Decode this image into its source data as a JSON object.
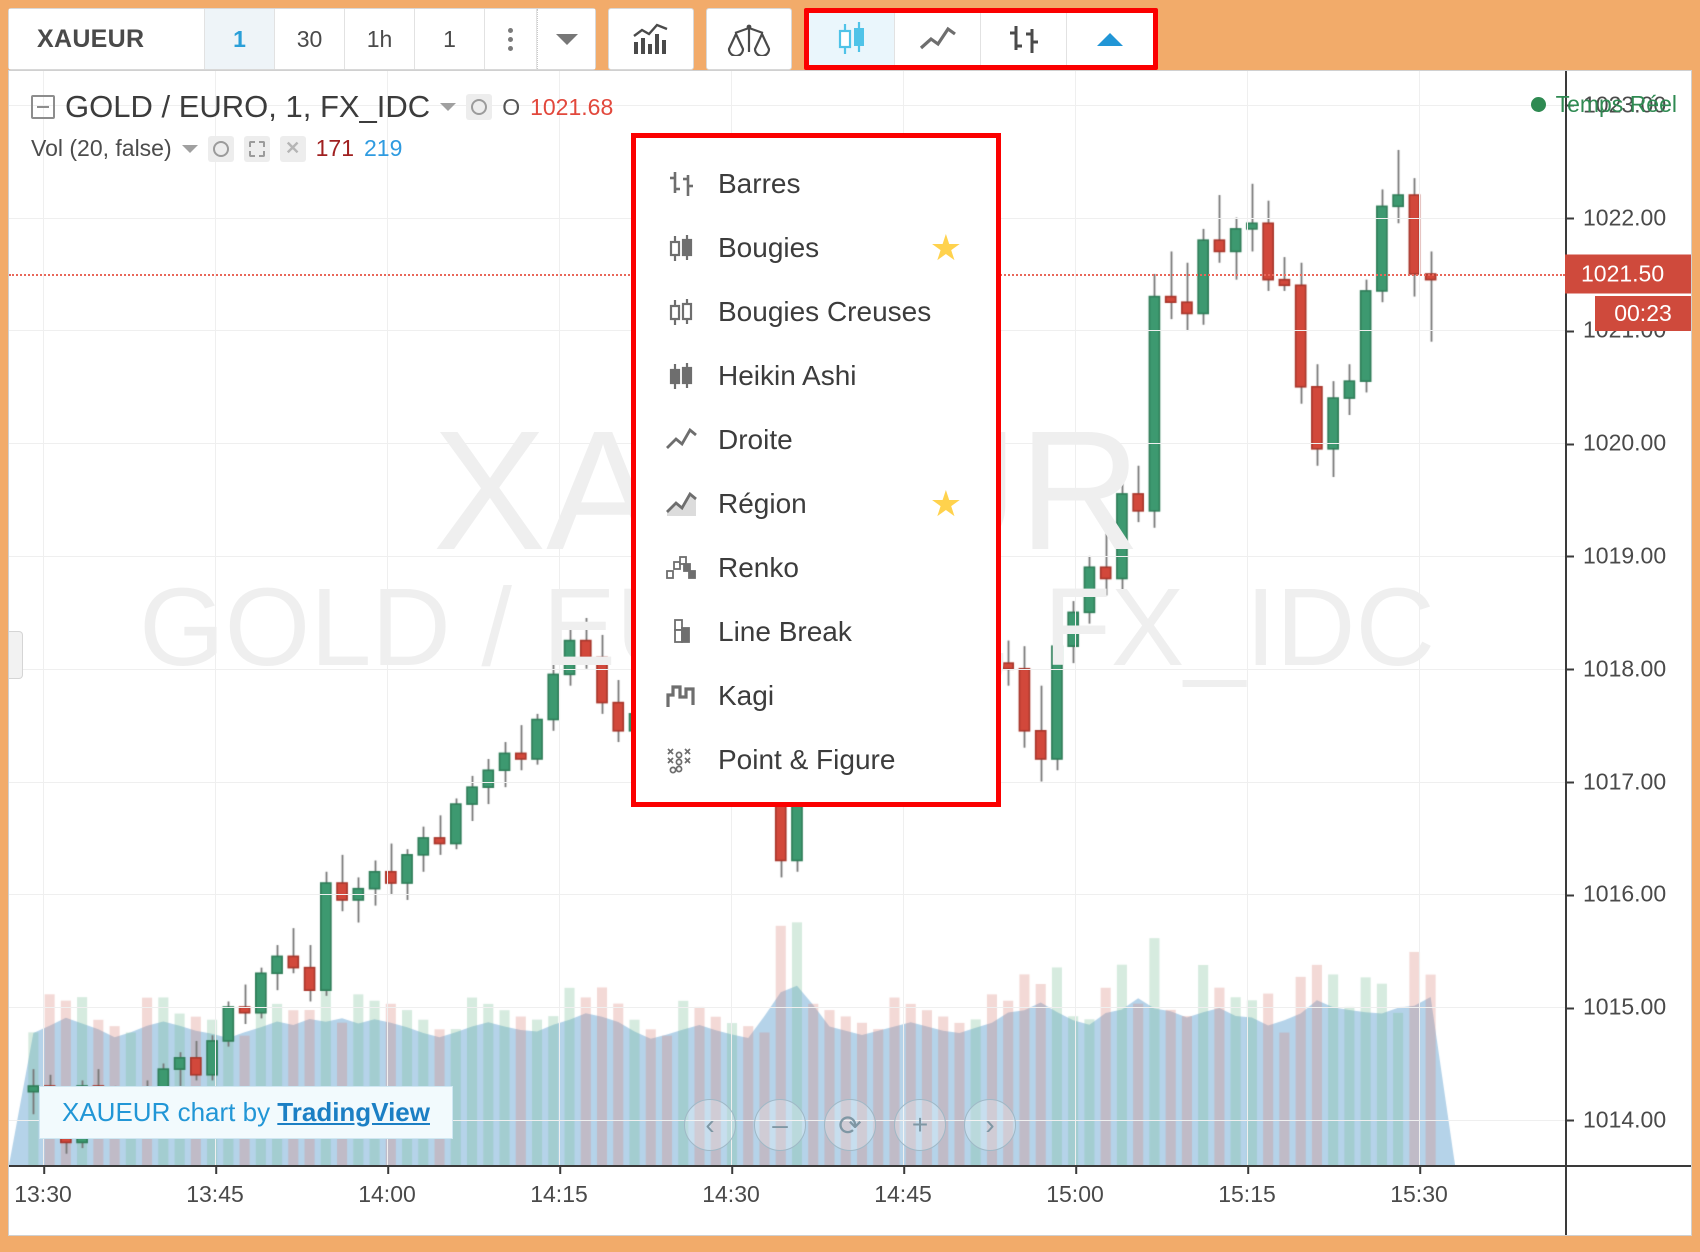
{
  "toolbar": {
    "symbol": "XAUEUR",
    "intervals": [
      {
        "label": "1",
        "active": true
      },
      {
        "label": "30",
        "active": false
      },
      {
        "label": "1h",
        "active": false
      },
      {
        "label": "1",
        "active": false
      }
    ],
    "more_icon": "kebab-menu-icon",
    "caret_icon": "chevron-down-icon",
    "indicators_icon": "indicators-chart-icon",
    "compare_icon": "balance-scale-icon",
    "styles": [
      {
        "name": "candles-icon",
        "selected": true
      },
      {
        "name": "line-icon",
        "selected": false
      },
      {
        "name": "bars-icon",
        "selected": false
      }
    ],
    "expand_icon": "triangle-up-icon"
  },
  "style_menu": {
    "items": [
      {
        "label": "Barres",
        "icon": "bars-icon",
        "starred": false
      },
      {
        "label": "Bougies",
        "icon": "candles-icon",
        "starred": true
      },
      {
        "label": "Bougies Creuses",
        "icon": "hollow-candles-icon",
        "starred": false
      },
      {
        "label": "Heikin Ashi",
        "icon": "heikin-ashi-icon",
        "starred": false
      },
      {
        "label": "Droite",
        "icon": "line-icon",
        "starred": false
      },
      {
        "label": "Région",
        "icon": "area-icon",
        "starred": true
      },
      {
        "label": "Renko",
        "icon": "renko-icon",
        "starred": false
      },
      {
        "label": "Line Break",
        "icon": "line-break-icon",
        "starred": false
      },
      {
        "label": "Kagi",
        "icon": "kagi-icon",
        "starred": false
      },
      {
        "label": "Point & Figure",
        "icon": "point-and-figure-icon",
        "starred": false
      }
    ],
    "star_glyph": "★"
  },
  "legend": {
    "collapse_icon": "collapse-icon",
    "title": "GOLD / EURO, 1, FX_IDC",
    "title_caret": "chevron-down-icon",
    "visibility_icon": "eye-icon",
    "ohlc_label": "O",
    "ohlc_value": "1021.68",
    "study_name": "Vol (20, false)",
    "study_caret": "chevron-down-icon",
    "study_eye_icon": "eye-icon",
    "study_gear_icon": "gear-icon",
    "study_close_icon": "close-icon",
    "study_value_1": "171",
    "study_value_2": "219"
  },
  "realtime": {
    "label": "Temps Réel",
    "dot_color": "#2f8a52"
  },
  "price_badge": {
    "price": "1021.50",
    "countdown": "00:23",
    "color": "#cf4a3c"
  },
  "tv_badge": {
    "prefix": "XAUEUR chart by ",
    "brand": "TradingView"
  },
  "nav_controls": [
    {
      "name": "scroll-left-button",
      "glyph": "‹"
    },
    {
      "name": "zoom-out-button",
      "glyph": "–"
    },
    {
      "name": "reset-chart-button",
      "glyph": "⟳"
    },
    {
      "name": "zoom-in-button",
      "glyph": "+"
    },
    {
      "name": "scroll-right-button",
      "glyph": "›"
    }
  ],
  "chart_data": {
    "type": "candlestick",
    "title": "GOLD / EURO, 1, FX_IDC",
    "symbol": "XAUEUR",
    "interval": "1",
    "source": "FX_IDC",
    "xlabel": "",
    "ylabel": "",
    "grid": true,
    "legend": "top-left",
    "ylim": [
      1013.6,
      1023.3
    ],
    "price_ticks": [
      "1023.00",
      "1022.00",
      "1021.00",
      "1020.00",
      "1019.00",
      "1018.00",
      "1017.00",
      "1016.00",
      "1015.00",
      "1014.00"
    ],
    "time_ticks": [
      "13:30",
      "13:45",
      "14:00",
      "14:15",
      "14:30",
      "14:45",
      "15:00",
      "15:15",
      "15:30"
    ],
    "current_price": 1021.5,
    "open_value": 1021.68,
    "up_color": "#3d9970",
    "down_color": "#d2483b",
    "volume_panel": {
      "label": "Vol (20, false)",
      "ma_value": 171,
      "last_value": 219,
      "area_color": "#8ec3e0"
    },
    "ohlc": [
      [
        1014.25,
        1014.45,
        1014.05,
        1014.3
      ],
      [
        1014.3,
        1014.4,
        1013.95,
        1014.0
      ],
      [
        1014.0,
        1014.15,
        1013.7,
        1013.8
      ],
      [
        1013.8,
        1014.35,
        1013.75,
        1014.3
      ],
      [
        1014.3,
        1014.45,
        1014.1,
        1014.15
      ],
      [
        1014.15,
        1014.3,
        1013.95,
        1014.05
      ],
      [
        1014.05,
        1014.25,
        1013.9,
        1014.2
      ],
      [
        1014.2,
        1014.35,
        1014.0,
        1014.1
      ],
      [
        1014.1,
        1014.5,
        1014.05,
        1014.45
      ],
      [
        1014.45,
        1014.6,
        1014.3,
        1014.55
      ],
      [
        1014.55,
        1014.7,
        1014.35,
        1014.4
      ],
      [
        1014.4,
        1014.75,
        1014.35,
        1014.7
      ],
      [
        1014.7,
        1015.05,
        1014.65,
        1015.0
      ],
      [
        1015.0,
        1015.2,
        1014.85,
        1014.95
      ],
      [
        1014.95,
        1015.35,
        1014.9,
        1015.3
      ],
      [
        1015.3,
        1015.55,
        1015.15,
        1015.45
      ],
      [
        1015.45,
        1015.7,
        1015.3,
        1015.35
      ],
      [
        1015.35,
        1015.55,
        1015.05,
        1015.15
      ],
      [
        1015.15,
        1016.2,
        1015.1,
        1016.1
      ],
      [
        1016.1,
        1016.35,
        1015.85,
        1015.95
      ],
      [
        1015.95,
        1016.15,
        1015.75,
        1016.05
      ],
      [
        1016.05,
        1016.3,
        1015.9,
        1016.2
      ],
      [
        1016.2,
        1016.45,
        1016.0,
        1016.1
      ],
      [
        1016.1,
        1016.4,
        1015.95,
        1016.35
      ],
      [
        1016.35,
        1016.6,
        1016.2,
        1016.5
      ],
      [
        1016.5,
        1016.7,
        1016.35,
        1016.45
      ],
      [
        1016.45,
        1016.85,
        1016.4,
        1016.8
      ],
      [
        1016.8,
        1017.05,
        1016.65,
        1016.95
      ],
      [
        1016.95,
        1017.2,
        1016.8,
        1017.1
      ],
      [
        1017.1,
        1017.35,
        1016.95,
        1017.25
      ],
      [
        1017.25,
        1017.5,
        1017.1,
        1017.2
      ],
      [
        1017.2,
        1017.6,
        1017.15,
        1017.55
      ],
      [
        1017.55,
        1018.05,
        1017.45,
        1017.95
      ],
      [
        1017.95,
        1018.35,
        1017.85,
        1018.25
      ],
      [
        1018.25,
        1018.45,
        1018.0,
        1018.1
      ],
      [
        1018.1,
        1018.3,
        1017.6,
        1017.7
      ],
      [
        1017.7,
        1017.9,
        1017.35,
        1017.45
      ],
      [
        1017.45,
        1017.7,
        1017.3,
        1017.6
      ],
      [
        1017.6,
        1017.8,
        1017.45,
        1017.55
      ],
      [
        1017.55,
        1017.75,
        1017.4,
        1017.5
      ],
      [
        1017.5,
        1017.7,
        1017.35,
        1017.6
      ],
      [
        1017.6,
        1017.8,
        1017.45,
        1017.55
      ],
      [
        1017.55,
        1017.7,
        1017.4,
        1017.45
      ],
      [
        1017.45,
        1017.65,
        1017.35,
        1017.55
      ],
      [
        1017.55,
        1017.75,
        1017.4,
        1017.5
      ],
      [
        1017.5,
        1017.65,
        1017.3,
        1017.4
      ],
      [
        1017.4,
        1017.6,
        1016.15,
        1016.3
      ],
      [
        1016.3,
        1018.55,
        1016.2,
        1018.45
      ],
      [
        1018.45,
        1018.7,
        1018.25,
        1018.4
      ],
      [
        1018.4,
        1018.6,
        1018.15,
        1018.3
      ],
      [
        1018.3,
        1018.5,
        1018.05,
        1018.2
      ],
      [
        1018.2,
        1018.4,
        1017.95,
        1018.1
      ],
      [
        1018.1,
        1018.3,
        1017.85,
        1018.0
      ],
      [
        1018.0,
        1018.2,
        1017.8,
        1017.95
      ],
      [
        1017.95,
        1018.15,
        1017.75,
        1017.9
      ],
      [
        1017.9,
        1018.1,
        1017.7,
        1017.85
      ],
      [
        1017.85,
        1018.05,
        1017.65,
        1017.8
      ],
      [
        1017.8,
        1018.0,
        1017.6,
        1017.75
      ],
      [
        1017.75,
        1018.25,
        1017.7,
        1018.15
      ],
      [
        1018.15,
        1018.35,
        1017.95,
        1018.05
      ],
      [
        1018.05,
        1018.25,
        1017.85,
        1018.0
      ],
      [
        1018.0,
        1018.2,
        1017.3,
        1017.45
      ],
      [
        1017.45,
        1017.85,
        1017.0,
        1017.2
      ],
      [
        1017.2,
        1018.3,
        1017.1,
        1018.2
      ],
      [
        1018.2,
        1018.6,
        1018.05,
        1018.5
      ],
      [
        1018.5,
        1019.0,
        1018.4,
        1018.9
      ],
      [
        1018.9,
        1019.2,
        1018.65,
        1018.8
      ],
      [
        1018.8,
        1019.7,
        1018.7,
        1019.55
      ],
      [
        1019.55,
        1019.8,
        1019.3,
        1019.4
      ],
      [
        1019.4,
        1021.5,
        1019.25,
        1021.3
      ],
      [
        1021.3,
        1021.7,
        1021.1,
        1021.25
      ],
      [
        1021.25,
        1021.6,
        1021.0,
        1021.15
      ],
      [
        1021.15,
        1021.9,
        1021.05,
        1021.8
      ],
      [
        1021.8,
        1022.2,
        1021.6,
        1021.7
      ],
      [
        1021.7,
        1022.0,
        1021.45,
        1021.9
      ],
      [
        1021.9,
        1022.3,
        1021.7,
        1021.95
      ],
      [
        1021.95,
        1022.15,
        1021.35,
        1021.45
      ],
      [
        1021.45,
        1021.65,
        1021.35,
        1021.4
      ],
      [
        1021.4,
        1021.6,
        1020.35,
        1020.5
      ],
      [
        1020.5,
        1020.7,
        1019.8,
        1019.95
      ],
      [
        1019.95,
        1020.55,
        1019.7,
        1020.4
      ],
      [
        1020.4,
        1020.7,
        1020.25,
        1020.55
      ],
      [
        1020.55,
        1021.45,
        1020.45,
        1021.35
      ],
      [
        1021.35,
        1022.25,
        1021.25,
        1022.1
      ],
      [
        1022.1,
        1022.6,
        1021.95,
        1022.2
      ],
      [
        1022.2,
        1022.35,
        1021.3,
        1021.5
      ],
      [
        1021.5,
        1021.7,
        1020.9,
        1021.45
      ]
    ]
  }
}
